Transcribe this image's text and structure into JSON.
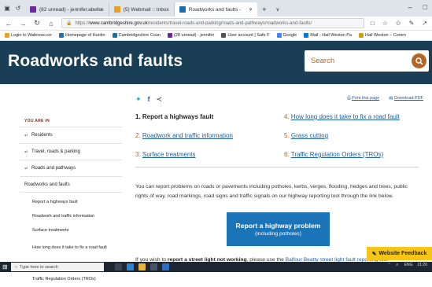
{
  "browser": {
    "tabs": [
      {
        "label": "(82 unread) - jennifer.abellæ",
        "color": "#6b2a9b",
        "active": false
      },
      {
        "label": "(5) Webmail :: Inbox",
        "color": "#e8a020",
        "active": false
      },
      {
        "label": "Roadworks and faults -  ",
        "color": "#1b6fa6",
        "active": true
      }
    ],
    "new_tab": "+",
    "tab_list": "∨",
    "url_prefix": "https://",
    "url_domain": "www.cambridgeshire.gov.uk",
    "url_path": "/residents/travel-roads-and-parking/roads-and-pathways/roadworks-and-faults/",
    "favorites": [
      {
        "label": "Login to Wabrose.cor",
        "color": "#f0a020"
      },
      {
        "label": "Homepage of Huntin",
        "color": "#2a6bb0"
      },
      {
        "label": "Cambridgeshire Coun",
        "color": "#1b6fa6"
      },
      {
        "label": "(28 unread) - jennifer",
        "color": "#6b2a9b"
      },
      {
        "label": "User account | Safe F",
        "color": "#555555"
      },
      {
        "label": "Google",
        "color": "#4285f4"
      },
      {
        "label": "Mail - Hail Weston Pa",
        "color": "#0078d4"
      },
      {
        "label": "Hail Weston – Comm",
        "color": "#c8a020"
      }
    ]
  },
  "header": {
    "title": "Roadworks and faults",
    "search_placeholder": "Search"
  },
  "sidebar": {
    "you_are_in": "YOU ARE IN",
    "breadcrumbs": [
      "Residents",
      "Travel, roads & parking",
      "Roads and pathways"
    ],
    "current": "Roadworks and faults",
    "items": [
      "Report a highways fault",
      "Roadwork and traffic information",
      "Surface treatments",
      "How long does it take to fix a road fault",
      "Grass cutting",
      "Traffic Regulation Orders (TROs)"
    ]
  },
  "content": {
    "print_label": "Print this page",
    "download_label": "Download PDF",
    "links": [
      {
        "num": "1.",
        "label": "Report a highways fault"
      },
      {
        "num": "2.",
        "label": "Roadwork and traffic information"
      },
      {
        "num": "3.",
        "label": "Surface treatments"
      },
      {
        "num": "4.",
        "label": "How long does it take to fix a road fault"
      },
      {
        "num": "5.",
        "label": "Grass cutting"
      },
      {
        "num": "6.",
        "label": "Traffic Regulation Orders (TROs)"
      }
    ],
    "intro": "You can report problems on roads or pavements including potholes, kerbs, verges, flooding, hedges and trees, public rights of way, road markings, road signs and traffic signals on our highway reporting tool through the link below.",
    "cta_line1": "Report a highway problem",
    "cta_line2": "(including potholes)",
    "para2_start": "If you wish to ",
    "para2_bold": "report a street light not working",
    "para2_mid": ", please use the ",
    "para2_link": "Balfour Beatty street light fault reporting tool"
  },
  "feedback": "Website Feedback",
  "taskbar": {
    "search_placeholder": "Type here to search",
    "lang": "ENG",
    "time": "21:20"
  }
}
